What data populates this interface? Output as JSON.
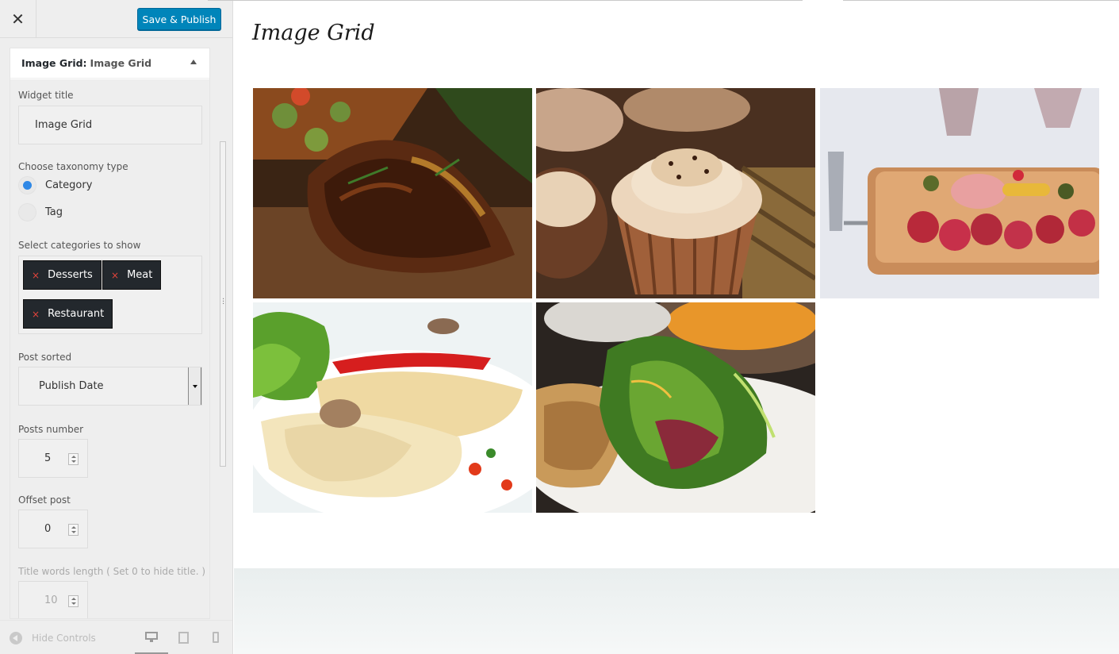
{
  "toolbar": {
    "close_label": "✕",
    "publish_label": "Save & Publish"
  },
  "widget_panel": {
    "header_type": "Image Grid:",
    "header_name": "Image Grid",
    "widget_title_label": "Widget title",
    "widget_title_value": "Image Grid",
    "taxonomy_label": "Choose taxonomy type",
    "taxonomy_options": [
      {
        "label": "Category",
        "checked": true
      },
      {
        "label": "Tag",
        "checked": false
      }
    ],
    "categories_label": "Select categories to show",
    "categories": [
      "Desserts",
      "Meat",
      "Restaurant"
    ],
    "chip_remove_glyph": "×",
    "post_sorted_label": "Post sorted",
    "post_sorted_value": "Publish Date",
    "posts_number_label": "Posts number",
    "posts_number_value": "5",
    "offset_label": "Offset post",
    "offset_value": "0",
    "title_words_label": "Title words length ( Set 0 to hide title. )",
    "title_words_value": "10"
  },
  "footer": {
    "hide_controls_label": "Hide Controls"
  },
  "preview": {
    "widget_title": "Image Grid",
    "images": [
      {
        "name": "grilled-ribs-image"
      },
      {
        "name": "cupcakes-image"
      },
      {
        "name": "charcuterie-board-image"
      },
      {
        "name": "crepes-plate-image"
      },
      {
        "name": "salad-wrap-image"
      }
    ]
  },
  "colors": {
    "accent": "#0085ba",
    "radio_checked": "#2f88e6",
    "chip_bg": "#23282d",
    "chip_x": "#e2443c"
  }
}
